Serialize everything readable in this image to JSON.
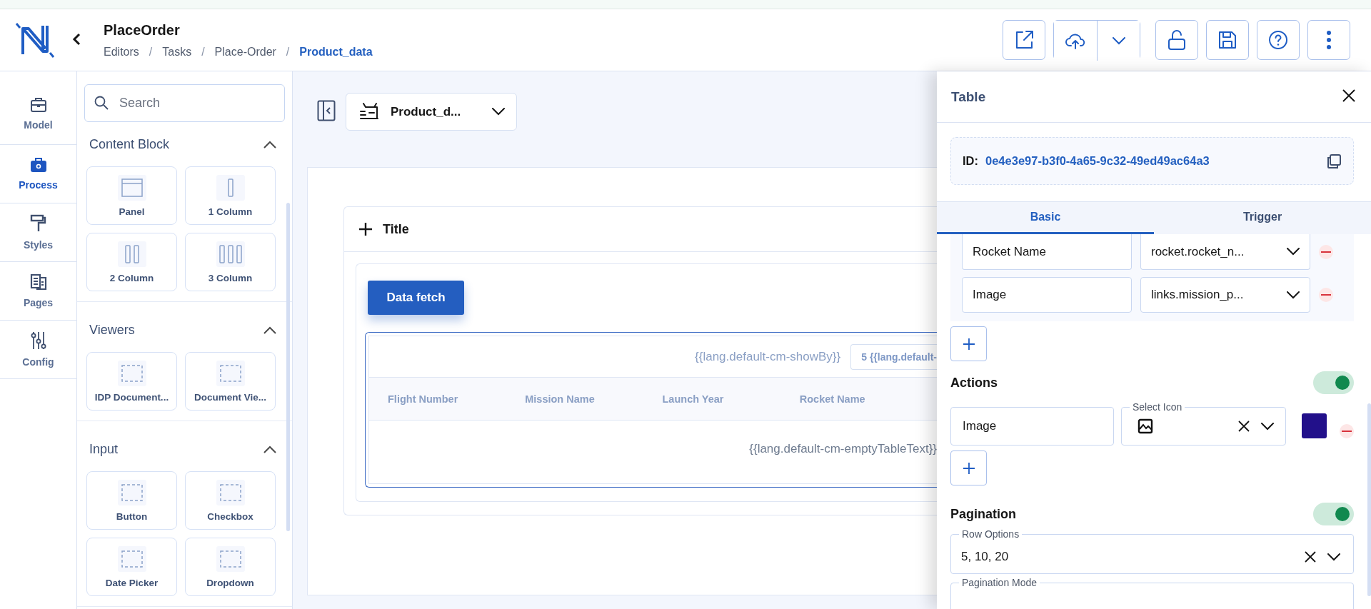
{
  "header": {
    "title": "PlaceOrder",
    "separators": [
      "/",
      "/",
      "/"
    ],
    "breadcrumb": [
      {
        "label": "Editors",
        "current": false
      },
      {
        "label": "Tasks",
        "current": false
      },
      {
        "label": "Place-Order",
        "current": false
      },
      {
        "label": "Product_data",
        "current": true
      }
    ]
  },
  "rail": [
    {
      "label": "Model",
      "kind": "briefcase",
      "selected": false
    },
    {
      "label": "Process",
      "kind": "process",
      "selected": true
    },
    {
      "label": "Styles",
      "kind": "roller",
      "selected": false
    },
    {
      "label": "Pages",
      "kind": "pages",
      "selected": false
    },
    {
      "label": "Config",
      "kind": "sliders",
      "selected": false
    }
  ],
  "palette": {
    "placeholder": "Search",
    "sections": [
      {
        "title": "Content Block",
        "expanded": true,
        "items": [
          {
            "label": "Panel",
            "kind": "panel"
          },
          {
            "label": "1 Column",
            "kind": "col1"
          },
          {
            "label": "2 Column",
            "kind": "col2"
          },
          {
            "label": "3 Column",
            "kind": "col3"
          }
        ]
      },
      {
        "title": "Viewers",
        "expanded": true,
        "items": [
          {
            "label": "IDP Document...",
            "kind": "dashed"
          },
          {
            "label": "Document Vie...",
            "kind": "dashed"
          }
        ]
      },
      {
        "title": "Input",
        "expanded": true,
        "items": [
          {
            "label": "Button",
            "kind": "dashed"
          },
          {
            "label": "Checkbox",
            "kind": "dashed"
          },
          {
            "label": "Date Picker",
            "kind": "dashed"
          },
          {
            "label": "Dropdown",
            "kind": "dashed"
          }
        ]
      }
    ]
  },
  "canvas": {
    "page_select": "Product_d...",
    "panel_title": "Title",
    "button": "Data fetch",
    "table": {
      "show_by": "{{lang.default-cm-showBy}}",
      "page_size": "5 {{lang.default-",
      "columns": [
        "Flight Number",
        "Mission Name",
        "Launch Year",
        "Rocket Name"
      ],
      "empty_text": "{{lang.default-cm-emptyTableText}}"
    }
  },
  "properties": {
    "title": "Table",
    "id_label": "ID:",
    "id": "0e4e3e97-b3f0-4a65-9c32-49ed49ac64a3",
    "tabs": [
      {
        "label": "Basic",
        "selected": true
      },
      {
        "label": "Trigger",
        "selected": false
      }
    ],
    "column_mappings": [
      {
        "label": "Rocket Name",
        "field": "rocket.rocket_n..."
      },
      {
        "label": "Image",
        "field": "links.mission_p..."
      }
    ],
    "actions": {
      "title": "Actions",
      "on": true,
      "items": [
        {
          "label": "Image",
          "icon_label": "Select Icon",
          "color": "#22108a"
        }
      ]
    },
    "pagination": {
      "title": "Pagination",
      "on": true,
      "row_options_label": "Row Options",
      "row_options": "5, 10, 20",
      "mode_label": "Pagination Mode"
    }
  }
}
